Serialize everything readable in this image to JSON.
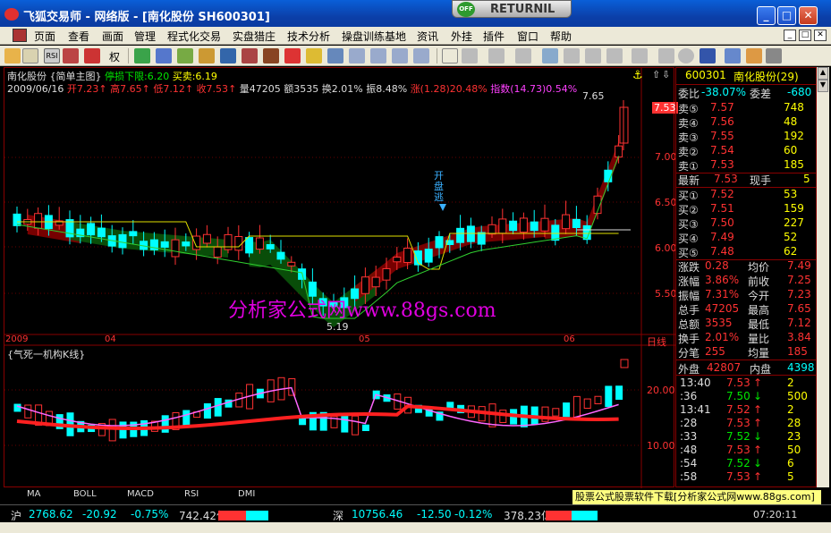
{
  "window": {
    "title": "飞狐交易师 - 网络版 - [南化股份 SH600301]",
    "returnil_label": "RETURNIL",
    "returnil_badge": "OFF",
    "minimize": "_",
    "maximize": "□",
    "close": "✕"
  },
  "menu": [
    "页面",
    "查看",
    "画面",
    "管理",
    "程式化交易",
    "实盘猎庄",
    "技术分析",
    "操盘训练基地",
    "资讯",
    "外挂",
    "插件",
    "窗口",
    "帮助"
  ],
  "menu_mdi": [
    "_",
    "□",
    "✕"
  ],
  "toolbar": {
    "quan_label": "权"
  },
  "chart": {
    "header": {
      "stock": "南化股份",
      "view": "{简单主图}",
      "stop_label": "停损下限:6.20",
      "buysell_label": "买卖:6.19"
    },
    "info": {
      "date": "2009/06/16",
      "open": "开7.23",
      "high": "高7.65",
      "low": "低7.12",
      "close": "收7.53",
      "vol": "量47205",
      "amount": "额3535",
      "turnover": "换2.01%",
      "amplitude": "振8.48%",
      "rise": "涨(1.28)20.48%",
      "index": "指数(14.73)0.54%"
    },
    "price_axis": [
      "7.53",
      "7.00",
      "6.50",
      "6.00",
      "5.50"
    ],
    "high_mark": "7.65",
    "low_mark": "5.19",
    "signal_text": "开盘逃",
    "watermark": "分析家公式网www.88gs.com",
    "date_axis": [
      "2009",
      "04",
      "05",
      "06"
    ],
    "period": "日线",
    "sub_title": "{气死一机构K线}",
    "sub_axis": [
      "20.00",
      "10.00"
    ]
  },
  "quote": {
    "code": "600301",
    "name": "南化股份(29)",
    "weibi_label": "委比",
    "weibi": "-38.07%",
    "weicha_label": "委差",
    "weicha": "-680",
    "sells": [
      {
        "label": "卖⑤",
        "price": "7.57",
        "vol": "748"
      },
      {
        "label": "卖④",
        "price": "7.56",
        "vol": "48"
      },
      {
        "label": "卖③",
        "price": "7.55",
        "vol": "192"
      },
      {
        "label": "卖②",
        "price": "7.54",
        "vol": "60"
      },
      {
        "label": "卖①",
        "price": "7.53",
        "vol": "185"
      }
    ],
    "latest_label": "最新",
    "latest": "7.53",
    "xianshou_label": "现手",
    "xianshou": "5",
    "buys": [
      {
        "label": "买①",
        "price": "7.52",
        "vol": "53"
      },
      {
        "label": "买②",
        "price": "7.51",
        "vol": "159"
      },
      {
        "label": "买③",
        "price": "7.50",
        "vol": "227"
      },
      {
        "label": "买④",
        "price": "7.49",
        "vol": "52"
      },
      {
        "label": "买⑤",
        "price": "7.48",
        "vol": "62"
      }
    ],
    "stats": [
      {
        "l1": "涨跌",
        "v1": "0.28",
        "l2": "均价",
        "v2": "7.49"
      },
      {
        "l1": "涨幅",
        "v1": "3.86%",
        "l2": "前收",
        "v2": "7.25"
      },
      {
        "l1": "振幅",
        "v1": "7.31%",
        "l2": "今开",
        "v2": "7.23"
      },
      {
        "l1": "总手",
        "v1": "47205",
        "l2": "最高",
        "v2": "7.65"
      },
      {
        "l1": "总额",
        "v1": "3535",
        "l2": "最低",
        "v2": "7.12"
      },
      {
        "l1": "换手",
        "v1": "2.01%",
        "l2": "量比",
        "v2": "3.84"
      },
      {
        "l1": "分笔",
        "v1": "255",
        "l2": "均量",
        "v2": "185"
      }
    ],
    "waipan_label": "外盘",
    "waipan": "42807",
    "neipan_label": "内盘",
    "neipan": "4398",
    "ticks": [
      {
        "time": "13:40",
        "price": "7.53",
        "dir": "↑",
        "vol": "2"
      },
      {
        "time": ":36",
        "price": "7.50",
        "dir": "↓",
        "vol": "500"
      },
      {
        "time": "13:41",
        "price": "7.52",
        "dir": "↑",
        "vol": "2"
      },
      {
        "time": ":28",
        "price": "7.53",
        "dir": "↑",
        "vol": "28"
      },
      {
        "time": ":33",
        "price": "7.52",
        "dir": "↓",
        "vol": "23"
      },
      {
        "time": ":48",
        "price": "7.53",
        "dir": "↑",
        "vol": "50"
      },
      {
        "time": ":54",
        "price": "7.52",
        "dir": "↓",
        "vol": "6"
      },
      {
        "time": ":58",
        "price": "7.53",
        "dir": "↑",
        "vol": "5"
      }
    ]
  },
  "tabs": [
    "MA",
    "BOLL",
    "MACD",
    "RSI",
    "DMI"
  ],
  "ad_text": "股票公式股票软件下载[分析家公式网www.88gs.com]",
  "status": {
    "sh_label": "沪",
    "sh_index": "2768.62",
    "sh_change": "-20.92",
    "sh_pct": "-0.75%",
    "sh_amount": "742.42亿",
    "sz_label": "深",
    "sz_index": "10756.46",
    "sz_change": "-12.50",
    "sz_pct": "-0.12%",
    "sz_amount": "378.23亿",
    "clock": "07:20:11"
  },
  "colors": {
    "up": "#ff3232",
    "down": "#00ffff",
    "bg": "#000000",
    "frame": "#800000"
  }
}
